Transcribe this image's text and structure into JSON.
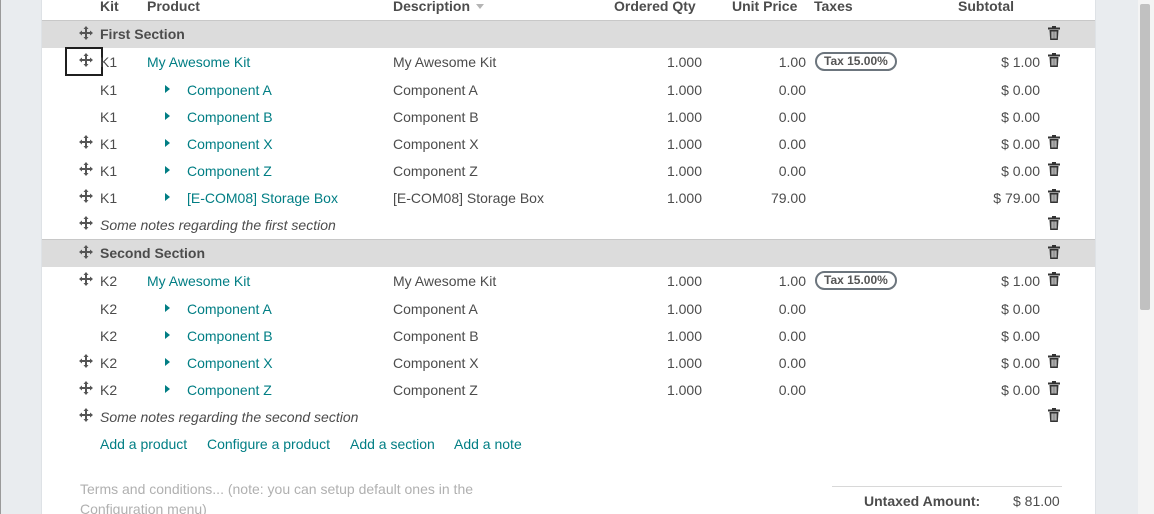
{
  "columns": {
    "kit": "Kit",
    "product": "Product",
    "description": "Description",
    "ordered_qty": "Ordered Qty",
    "unit_price": "Unit Price",
    "taxes": "Taxes",
    "subtotal": "Subtotal"
  },
  "sections": {
    "first": "First Section",
    "second": "Second Section"
  },
  "rows": {
    "r1": {
      "kit": "K1",
      "product": "My Awesome Kit",
      "description": "My Awesome Kit",
      "qty": "1.000",
      "price": "1.00",
      "tax": "Tax 15.00%",
      "subtotal": "$ 1.00"
    },
    "r2": {
      "kit": "K1",
      "product": "Component A",
      "description": "Component A",
      "qty": "1.000",
      "price": "0.00",
      "subtotal": "$ 0.00"
    },
    "r3": {
      "kit": "K1",
      "product": "Component B",
      "description": "Component B",
      "qty": "1.000",
      "price": "0.00",
      "subtotal": "$ 0.00"
    },
    "r4": {
      "kit": "K1",
      "product": "Component X",
      "description": "Component X",
      "qty": "1.000",
      "price": "0.00",
      "subtotal": "$ 0.00"
    },
    "r5": {
      "kit": "K1",
      "product": "Component Z",
      "description": "Component Z",
      "qty": "1.000",
      "price": "0.00",
      "subtotal": "$ 0.00"
    },
    "r6": {
      "kit": "K1",
      "product": "[E-COM08] Storage Box",
      "description": "[E-COM08] Storage Box",
      "qty": "1.000",
      "price": "79.00",
      "subtotal": "$ 79.00"
    },
    "r8": {
      "kit": "K2",
      "product": "My Awesome Kit",
      "description": "My Awesome Kit",
      "qty": "1.000",
      "price": "1.00",
      "tax": "Tax 15.00%",
      "subtotal": "$ 1.00"
    },
    "r9": {
      "kit": "K2",
      "product": "Component A",
      "description": "Component A",
      "qty": "1.000",
      "price": "0.00",
      "subtotal": "$ 0.00"
    },
    "r10": {
      "kit": "K2",
      "product": "Component B",
      "description": "Component B",
      "qty": "1.000",
      "price": "0.00",
      "subtotal": "$ 0.00"
    },
    "r11": {
      "kit": "K2",
      "product": "Component X",
      "description": "Component X",
      "qty": "1.000",
      "price": "0.00",
      "subtotal": "$ 0.00"
    },
    "r12": {
      "kit": "K2",
      "product": "Component Z",
      "description": "Component Z",
      "qty": "1.000",
      "price": "0.00",
      "subtotal": "$ 0.00"
    }
  },
  "notes": {
    "first": "Some notes regarding the first section",
    "second": "Some notes regarding the second section"
  },
  "actions": {
    "add_product": "Add a product",
    "configure_product": "Configure a product",
    "add_section": "Add a section",
    "add_note": "Add a note"
  },
  "terms": {
    "placeholder": "Terms and conditions... (note: you can setup default ones in the Configuration menu)"
  },
  "totals": {
    "untaxed_label": "Untaxed Amount:",
    "untaxed_value": "$ 81.00"
  },
  "colors": {
    "link": "#017e84",
    "section_bg": "#dcdcdc",
    "tax_badge_border": "#6c757d"
  },
  "icons": {
    "drag": "drag-handle-icon",
    "delete": "trash-icon",
    "expand": "caret-right-icon",
    "sort": "sort-caret-icon"
  }
}
